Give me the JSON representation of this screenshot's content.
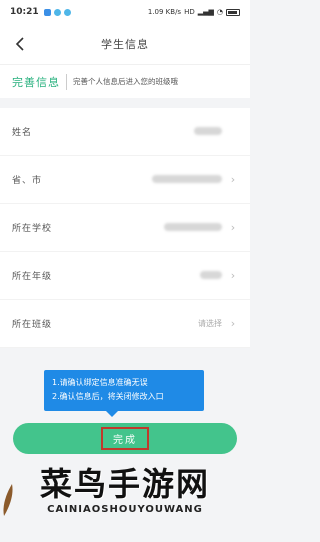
{
  "status_bar": {
    "time": "10:21",
    "network": "1.09 KB/s",
    "signal": "HD",
    "battery": ""
  },
  "nav": {
    "title": "学生信息"
  },
  "tip": {
    "tag": "完善信息",
    "desc": "完善个人信息后进入您的班级哦"
  },
  "form": {
    "rows": [
      {
        "label": "姓名",
        "value": "",
        "has_chevron": false
      },
      {
        "label": "省、市",
        "value": "",
        "has_chevron": true
      },
      {
        "label": "所在学校",
        "value": "",
        "has_chevron": true
      },
      {
        "label": "所在年级",
        "value": "",
        "has_chevron": true
      },
      {
        "label": "所在班级",
        "value": "请选择",
        "has_chevron": true
      }
    ]
  },
  "tooltip": {
    "line1": "1.请确认绑定信息准确无误",
    "line2": "2.确认信息后，将关闭修改入口"
  },
  "submit": {
    "label": "完成"
  },
  "watermark": {
    "cn": "菜鸟手游网",
    "en": "CAINIAOSHOUYOUWANG"
  },
  "colors": {
    "accent": "#26b07d",
    "button": "#43c48c",
    "tooltip": "#1f8ae6",
    "highlight": "#c0392b"
  }
}
